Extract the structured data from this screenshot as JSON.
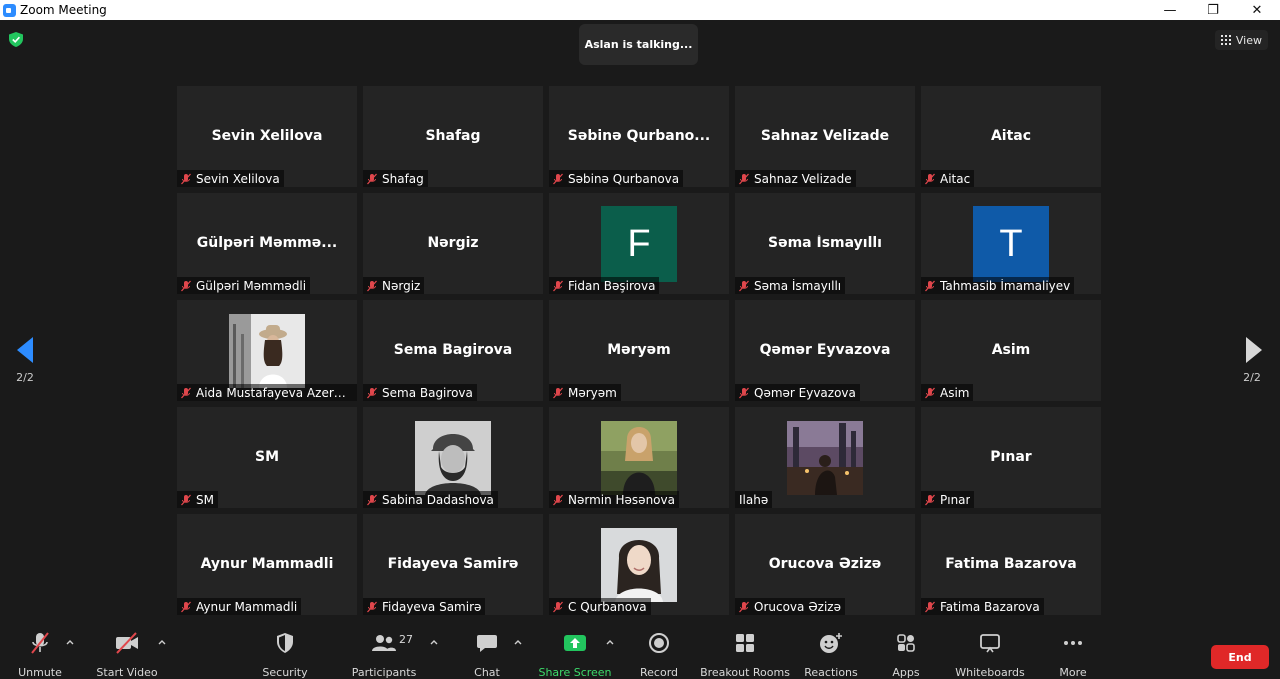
{
  "window": {
    "title": "Zoom Meeting",
    "min": "—",
    "max": "❐",
    "close": "✕"
  },
  "stage": {
    "talking": "Aslan is talking...",
    "view_label": "View",
    "page_left": "2/2",
    "page_right": "2/2"
  },
  "tiles": [
    {
      "big": "Sevin Xelilova",
      "name": "Sevin Xelilova",
      "type": "text"
    },
    {
      "big": "Shafag",
      "name": "Shafag",
      "type": "text"
    },
    {
      "big": "Səbinə Qurbano...",
      "name": "Səbinə Qurbanova",
      "type": "text"
    },
    {
      "big": "Sahnaz Velizade",
      "name": "Sahnaz Velizade",
      "type": "text"
    },
    {
      "big": "Aitac",
      "name": "Aitac",
      "type": "text"
    },
    {
      "big": "Gülpəri Məmmə...",
      "name": "Gülpəri Məmmədli",
      "type": "text"
    },
    {
      "big": "Nərgiz",
      "name": "Nərgiz",
      "type": "text"
    },
    {
      "big": "F",
      "name": "Fidan Bəşirova",
      "type": "letter",
      "color": "#0b5e4b"
    },
    {
      "big": "Səma İsmayıllı",
      "name": "Səma İsmayıllı",
      "type": "text"
    },
    {
      "big": "T",
      "name": "Tahmasib İmamaliyev",
      "type": "letter",
      "color": "#0f5aa8"
    },
    {
      "big": "",
      "name": "Aida Mustafayeva Azerbay...",
      "type": "photo",
      "photo": "photo-girl-hat"
    },
    {
      "big": "Sema Bagirova",
      "name": "Sema Bagirova",
      "type": "text"
    },
    {
      "big": "Məryəm",
      "name": "Məryəm",
      "type": "text"
    },
    {
      "big": "Qəmər Eyvazova",
      "name": "Qəmər Eyvazova",
      "type": "text"
    },
    {
      "big": "Asim",
      "name": "Asim",
      "type": "text"
    },
    {
      "big": "SM",
      "name": "SM",
      "type": "text"
    },
    {
      "big": "",
      "name": "Sabina Dadashova",
      "type": "photo",
      "photo": "photo-bw-cap"
    },
    {
      "big": "",
      "name": "Nərmin Həsənova",
      "type": "photo",
      "photo": "photo-outdoor"
    },
    {
      "big": "",
      "name": "Ilahə",
      "type": "photo",
      "photo": "photo-city-night",
      "unmuted": true
    },
    {
      "big": "Pınar",
      "name": "Pınar",
      "type": "text"
    },
    {
      "big": "Aynur Mammadli",
      "name": "Aynur Mammadli",
      "type": "text"
    },
    {
      "big": "Fidayeva Samirə",
      "name": "Fidayeva Samirə",
      "type": "text"
    },
    {
      "big": "",
      "name": "C Qurbanova",
      "type": "photo",
      "photo": "photo-portrait"
    },
    {
      "big": "Orucova Əzizə",
      "name": "Orucova Əzizə",
      "type": "text"
    },
    {
      "big": "Fatima Bazarova",
      "name": "Fatima Bazarova",
      "type": "text"
    }
  ],
  "toolbar": {
    "unmute": "Unmute",
    "start_video": "Start Video",
    "security": "Security",
    "participants": "Participants",
    "participants_count": "27",
    "chat": "Chat",
    "share_screen": "Share Screen",
    "record": "Record",
    "breakout": "Breakout Rooms",
    "reactions": "Reactions",
    "apps": "Apps",
    "whiteboards": "Whiteboards",
    "more": "More",
    "end": "End"
  },
  "colors": {
    "accent": "#2d8cff",
    "share_green": "#22c55e",
    "end_red": "#e02828",
    "muted_red": "#e0474c"
  }
}
